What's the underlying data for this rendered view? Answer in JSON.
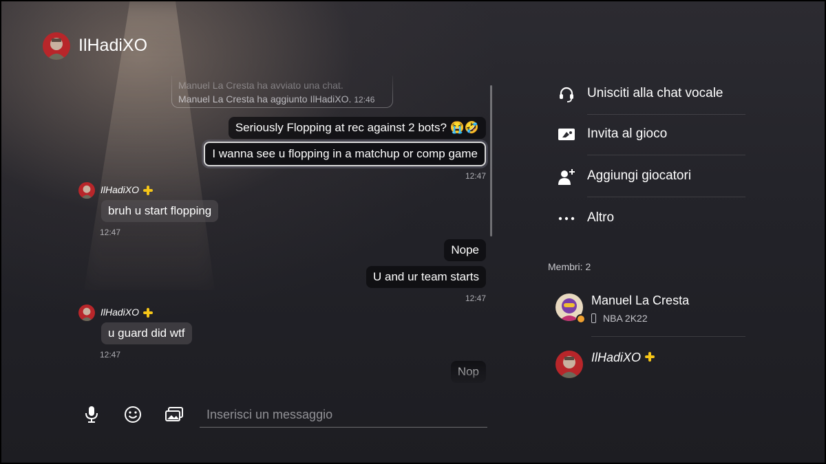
{
  "header": {
    "username": "IlHadiXO",
    "avatar_icon": "profile-avatar-soldier"
  },
  "chat": {
    "system_messages": [
      {
        "text": "Manuel La Cresta ha avviato una chat."
      },
      {
        "text": "Manuel La Cresta ha aggiunto IlHadiXO.",
        "time": "12:46"
      }
    ],
    "messages": [
      {
        "side": "right",
        "text": "Seriously Flopping at rec against 2 bots? 😭🤣"
      },
      {
        "side": "right",
        "text": "I wanna see u flopping in a matchup or comp game",
        "selected": true
      },
      {
        "time_right_1": "12:47"
      },
      {
        "sender": "IlHadiXO",
        "text": "bruh u start flopping",
        "time": "12:47"
      },
      {
        "side": "right",
        "text": "Nope"
      },
      {
        "side": "right",
        "text": "U and ur team starts"
      },
      {
        "time_right_2": "12:47"
      },
      {
        "sender": "IlHadiXO",
        "text": "u guard did wtf",
        "time": "12:47"
      },
      {
        "side": "right",
        "text": "Nop"
      }
    ],
    "r1": "Seriously Flopping at rec against 2 bots? 😭🤣",
    "r2": "I wanna see u flopping in a matchup or comp game",
    "t1": "12:47",
    "sender1": "IlHadiXO",
    "l1": "bruh u start flopping",
    "t2": "12:47",
    "r3": "Nope",
    "r4": "U and ur team starts",
    "t3": "12:47",
    "sender2": "IlHadiXO",
    "l2": "u guard did wtf",
    "t4": "12:47",
    "r5": "Nop",
    "sys1": "Manuel La Cresta ha avviato una chat.",
    "sys2": "Manuel La Cresta ha aggiunto IlHadiXO.",
    "sys2_time": "12:46"
  },
  "input": {
    "placeholder": "Inserisci un messaggio"
  },
  "input_icons": [
    "microphone-icon",
    "emoji-icon",
    "media-gallery-icon"
  ],
  "menu": {
    "voice": "Unisciti alla chat vocale",
    "invite": "Invita al gioco",
    "add": "Aggiungi giocatori",
    "more": "Altro"
  },
  "members": {
    "header": "Membri: 2",
    "list": [
      {
        "name": "Manuel La Cresta",
        "game": "NBA 2K22",
        "status": "online"
      },
      {
        "name": "IlHadiXO",
        "ps_plus": true
      }
    ]
  },
  "colors": {
    "ps_plus": "#f5c518",
    "online": "#f0a030"
  }
}
